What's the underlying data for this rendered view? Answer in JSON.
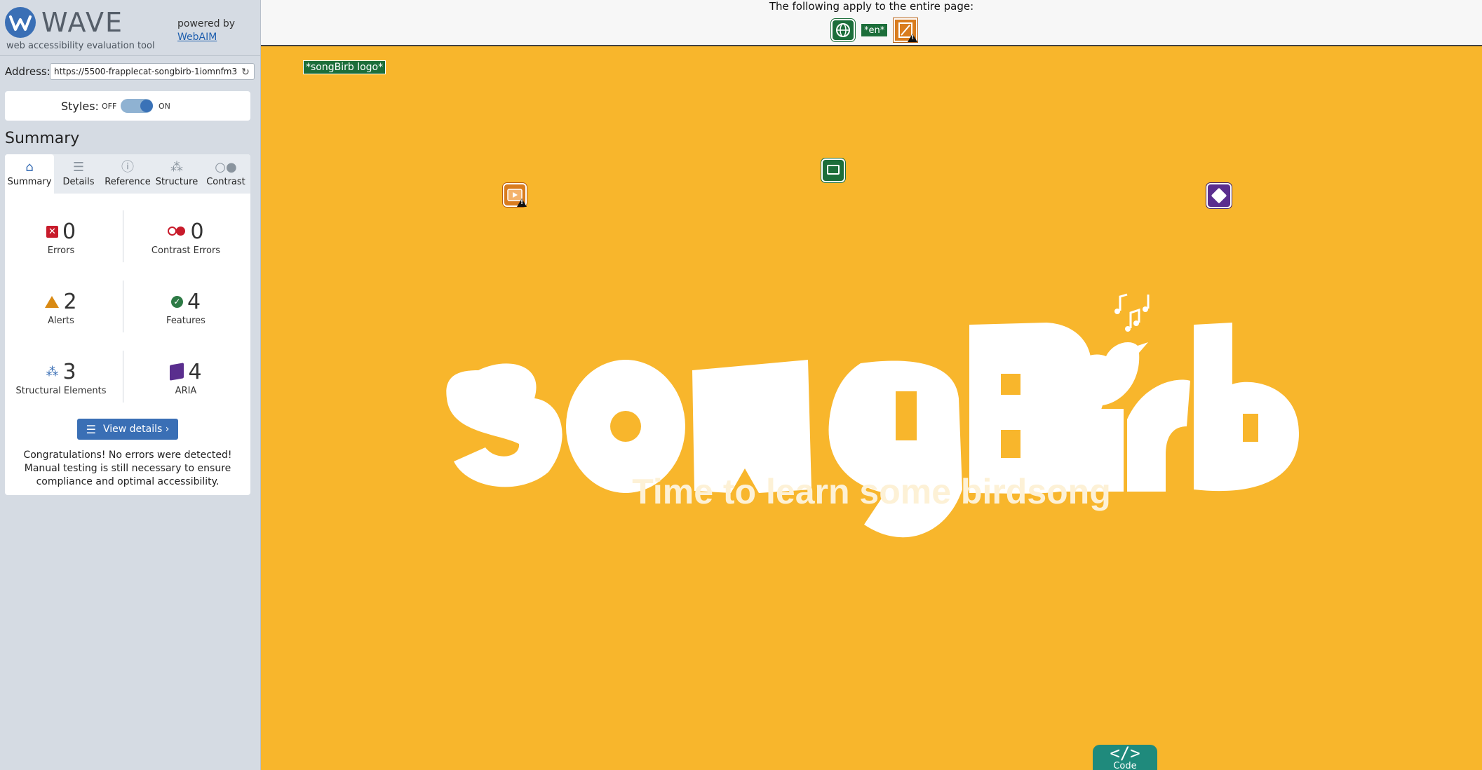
{
  "sidebar": {
    "brand": {
      "name": "WAVE",
      "tagline": "web accessibility evaluation tool",
      "powered_by": "powered by",
      "powered_link": "WebAIM"
    },
    "address": {
      "label": "Address:",
      "value": "https://5500-frapplecat-songbirb-1iomnfm3"
    },
    "styles": {
      "label": "Styles:",
      "off": "OFF",
      "on": "ON",
      "state": "on"
    },
    "heading": "Summary",
    "tabs": [
      {
        "label": "Summary",
        "icon": "home-icon",
        "active": true
      },
      {
        "label": "Details",
        "icon": "list-icon",
        "active": false
      },
      {
        "label": "Reference",
        "icon": "info-icon",
        "active": false
      },
      {
        "label": "Structure",
        "icon": "structure-icon",
        "active": false
      },
      {
        "label": "Contrast",
        "icon": "contrast-icon",
        "active": false
      }
    ],
    "stats": {
      "errors": {
        "count": "0",
        "label": "Errors"
      },
      "contrast_errors": {
        "count": "0",
        "label": "Contrast Errors"
      },
      "alerts": {
        "count": "2",
        "label": "Alerts"
      },
      "features": {
        "count": "4",
        "label": "Features"
      },
      "structural": {
        "count": "3",
        "label": "Structural Elements"
      },
      "aria": {
        "count": "4",
        "label": "ARIA"
      }
    },
    "view_details": "View details ›",
    "congrats": "Congratulations! No errors were detected! Manual testing is still necessary to ensure compliance and optimal accessibility."
  },
  "topbar": {
    "text": "The following apply to the entire page:",
    "lang_badge": "*en*"
  },
  "page": {
    "logo_label": "*songBirb logo*",
    "logo_text": "songBirb",
    "tagline": "Time to learn some birdsong",
    "code_tab": {
      "glyph": "</>",
      "label": "Code"
    }
  },
  "colors": {
    "page_bg": "#f8b62c",
    "sidebar_bg": "#d5dbe3",
    "accent": "#3a6fb5",
    "error": "#c81b2b",
    "alert": "#d98a13",
    "feature": "#2d7a45",
    "aria": "#5a2e8e"
  }
}
